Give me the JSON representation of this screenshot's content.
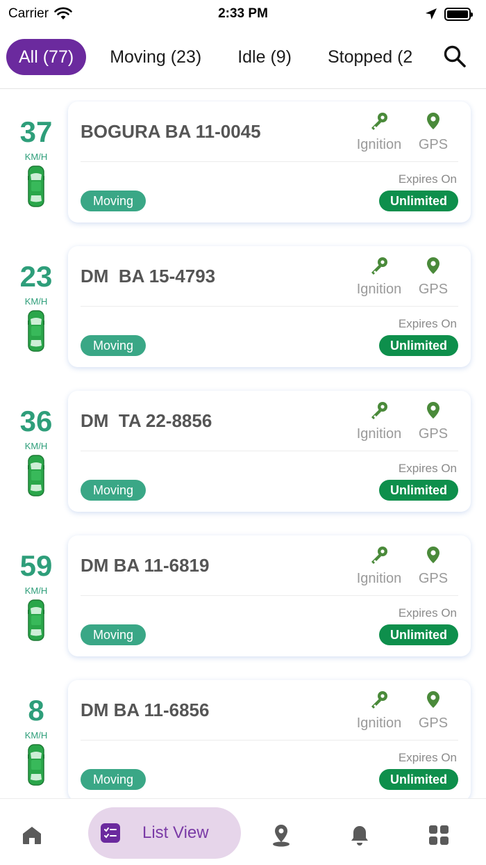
{
  "status_bar": {
    "carrier": "Carrier",
    "time": "2:33 PM"
  },
  "tabs": [
    {
      "label": "All (77)",
      "active": true
    },
    {
      "label": "Moving (23)",
      "active": false
    },
    {
      "label": "Idle (9)",
      "active": false
    },
    {
      "label": "Stopped (2",
      "active": false
    }
  ],
  "icons": {
    "search": "search-icon",
    "ignition": "key-icon",
    "gps": "location-pin-icon",
    "car": "car-top-view-icon"
  },
  "colors": {
    "accent_purple": "#6b2a9e",
    "speed_green": "#2e9e7a",
    "moving_badge": "#3aa786",
    "unlimited_badge": "#0e8f4c",
    "indicator_green": "#4a8a3a",
    "car_green": "#2aa64a"
  },
  "vehicles": [
    {
      "speed": "37",
      "unit": "KM/H",
      "plate": "BOGURA BA 11-0045",
      "ignition_label": "Ignition",
      "gps_label": "GPS",
      "expires_label": "Expires On",
      "status": "Moving",
      "validity": "Unlimited"
    },
    {
      "speed": "23",
      "unit": "KM/H",
      "plate": "DM  BA 15-4793",
      "ignition_label": "Ignition",
      "gps_label": "GPS",
      "expires_label": "Expires On",
      "status": "Moving",
      "validity": "Unlimited"
    },
    {
      "speed": "36",
      "unit": "KM/H",
      "plate": "DM  TA 22-8856",
      "ignition_label": "Ignition",
      "gps_label": "GPS",
      "expires_label": "Expires On",
      "status": "Moving",
      "validity": "Unlimited"
    },
    {
      "speed": "59",
      "unit": "KM/H",
      "plate": "DM BA 11-6819",
      "ignition_label": "Ignition",
      "gps_label": "GPS",
      "expires_label": "Expires On",
      "status": "Moving",
      "validity": "Unlimited"
    },
    {
      "speed": "8",
      "unit": "KM/H",
      "plate": "DM BA 11-6856",
      "ignition_label": "Ignition",
      "gps_label": "GPS",
      "expires_label": "Expires On",
      "status": "Moving",
      "validity": "Unlimited"
    }
  ],
  "bottom_nav": {
    "active_label": "List View",
    "items": [
      "home-icon",
      "list-view-icon",
      "map-pin-icon",
      "bell-icon",
      "grid-icon"
    ]
  }
}
